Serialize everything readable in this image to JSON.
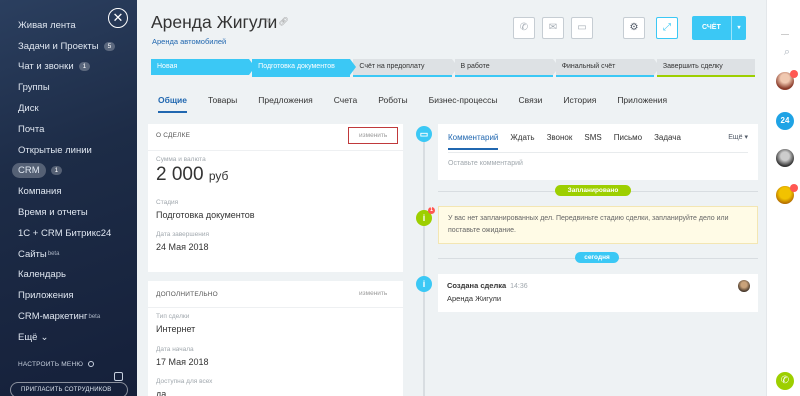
{
  "sidebar": {
    "items": [
      {
        "label": "Живая лента"
      },
      {
        "label": "Задачи и Проекты",
        "count": "5"
      },
      {
        "label": "Чат и звонки",
        "count": "1"
      },
      {
        "label": "Группы"
      },
      {
        "label": "Диск"
      },
      {
        "label": "Почта"
      },
      {
        "label": "Открытые линии"
      },
      {
        "label": "CRM",
        "count": "1",
        "active": true
      },
      {
        "label": "Компания"
      },
      {
        "label": "Время и отчеты"
      },
      {
        "label": "1С + CRM Битрикс24"
      },
      {
        "label": "Сайты",
        "sup": "beta"
      },
      {
        "label": "Календарь"
      },
      {
        "label": "Приложения"
      },
      {
        "label": "CRM-маркетинг",
        "sup": "beta"
      },
      {
        "label": "Ещё",
        "arrow": "⌄"
      }
    ],
    "settings_label": "НАСТРОИТЬ МЕНЮ",
    "invite_label": "ПРИГЛАСИТЬ СОТРУДНИКОВ",
    "close_icon": "close-icon"
  },
  "header": {
    "title": "Аренда Жигули",
    "subtitle": "Аренда автомобилей",
    "action_button": "СЧЁТ",
    "action_arrow": "▾",
    "icons": [
      "phone-icon",
      "mail-icon",
      "chat-icon",
      "gear-icon",
      "expand-icon"
    ]
  },
  "stages": [
    {
      "label": "Новая",
      "done": true
    },
    {
      "label": "Подготовка документов",
      "done": true,
      "underline": "#3bc8f5"
    },
    {
      "label": "Счёт на предоплату",
      "done": false,
      "underline": "#3bc8f5"
    },
    {
      "label": "В работе",
      "done": false,
      "underline": "#3bc8f5"
    },
    {
      "label": "Финальный счёт",
      "done": false,
      "underline": "#3bc8f5"
    },
    {
      "label": "Завершить сделку",
      "done": false,
      "underline": "#9dcf00"
    }
  ],
  "tabs": [
    "Общие",
    "Товары",
    "Предложения",
    "Счета",
    "Роботы",
    "Бизнес-процессы",
    "Связи",
    "История",
    "Приложения"
  ],
  "about_card": {
    "title": "О СДЕЛКЕ",
    "edit": "изменить",
    "amount_label": "Сумма и валюта",
    "amount_value": "2 000",
    "amount_currency": "руб",
    "stage_label": "Стадия",
    "stage_value": "Подготовка документов",
    "close_label": "Дата завершения",
    "close_value": "24 Мая 2018"
  },
  "extra_card": {
    "title": "ДОПОЛНИТЕЛЬНО",
    "edit": "изменить",
    "type_label": "Тип сделки",
    "type_value": "Интернет",
    "start_label": "Дата начала",
    "start_value": "17 Мая 2018",
    "access_label": "Доступна для всех",
    "access_value": "да"
  },
  "activity": {
    "tabs": [
      "Комментарий",
      "Ждать",
      "Звонок",
      "SMS",
      "Письмо",
      "Задача"
    ],
    "more": "Ещё ▾",
    "placeholder": "Оставьте комментарий",
    "planned_label": "Запланировано",
    "warning_text": "У вас нет запланированных дел. Передвиньте стадию сделки, запланируйте дело или поставьте ожидание.",
    "today_label": "сегодня",
    "event_title": "Создана сделка",
    "event_time": "14:36",
    "event_text": "Аренда Жигули",
    "warn_badge": "1"
  },
  "rightbar": {
    "counter": "24"
  }
}
